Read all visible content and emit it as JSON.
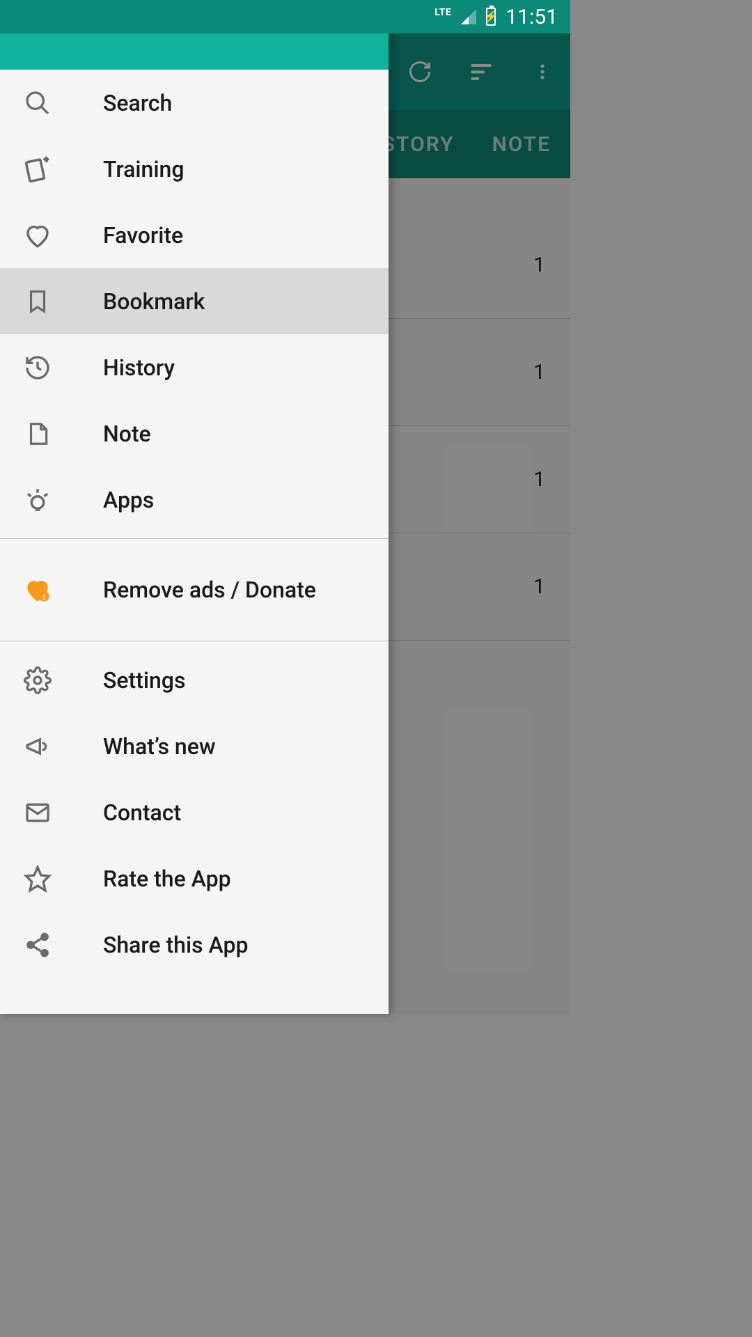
{
  "status": {
    "network": "LTE",
    "time": "11:51"
  },
  "tabs": {
    "history": "STORY",
    "note": "NOTE"
  },
  "list": {
    "counts": [
      "1",
      "1",
      "1",
      "1"
    ]
  },
  "drawer": {
    "items": [
      {
        "icon": "search-icon",
        "label": "Search",
        "selected": false
      },
      {
        "icon": "cards-icon",
        "label": "Training",
        "selected": false
      },
      {
        "icon": "heart-icon",
        "label": "Favorite",
        "selected": false
      },
      {
        "icon": "bookmark-icon",
        "label": "Bookmark",
        "selected": true
      },
      {
        "icon": "history-icon",
        "label": "History",
        "selected": false
      },
      {
        "icon": "note-icon",
        "label": "Note",
        "selected": false
      },
      {
        "icon": "bulb-icon",
        "label": "Apps",
        "selected": false
      }
    ],
    "donate": {
      "icon": "heart-donate-icon",
      "label": "Remove ads / Donate"
    },
    "lower": [
      {
        "icon": "gear-icon",
        "label": "Settings"
      },
      {
        "icon": "megaphone-icon",
        "label": "What’s new"
      },
      {
        "icon": "mail-icon",
        "label": "Contact"
      },
      {
        "icon": "star-icon",
        "label": "Rate the App"
      },
      {
        "icon": "share-icon",
        "label": "Share this App"
      }
    ]
  },
  "colors": {
    "accent": "#10b39b",
    "statusbar": "#0b8a7a",
    "drawer_bg": "#f5f5f5",
    "selected_bg": "#d9d9d9",
    "icon_gray": "#6a6a6a",
    "donate_orange": "#f79a1a"
  }
}
